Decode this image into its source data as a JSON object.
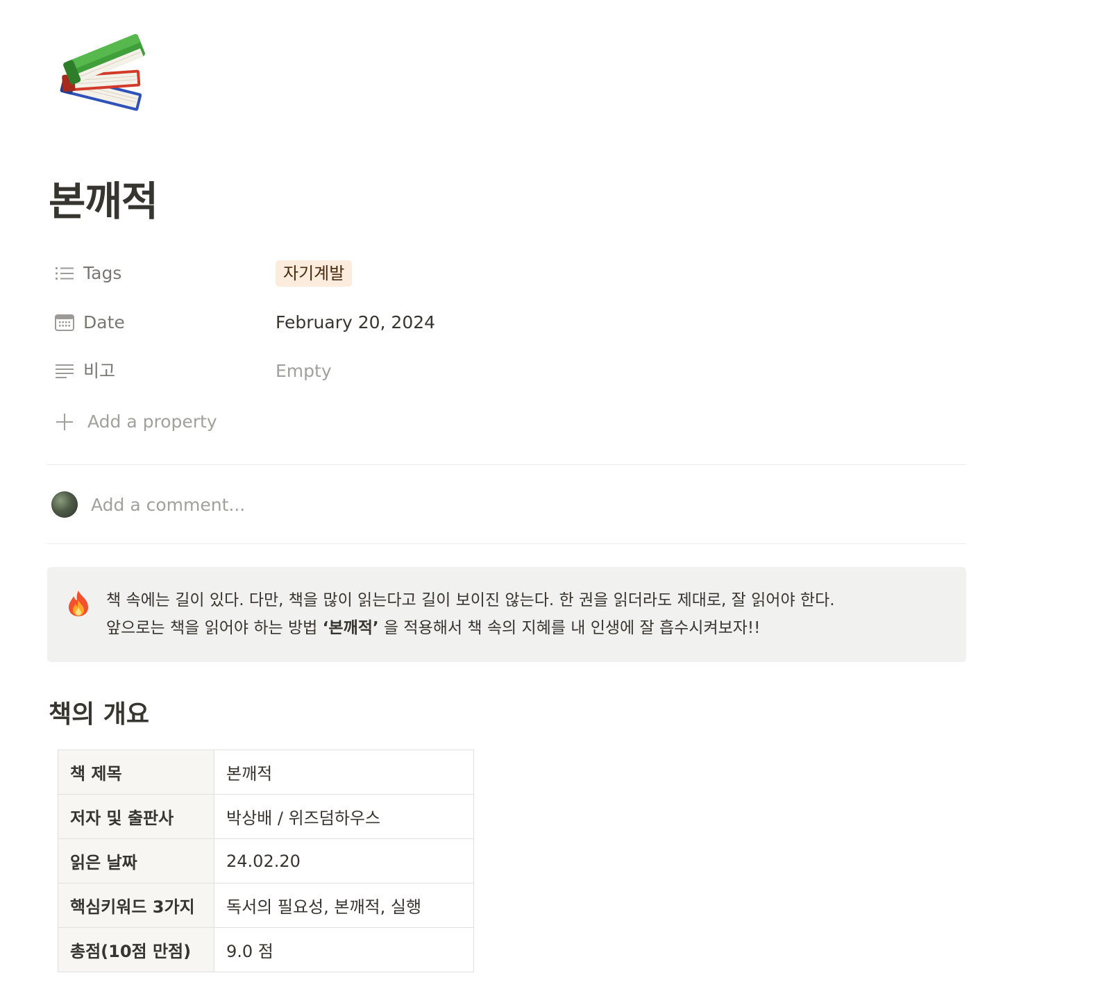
{
  "page": {
    "icon": "books-emoji-icon",
    "title": "본깨적"
  },
  "properties": [
    {
      "name": "Tags",
      "icon": "list-icon",
      "type": "tag",
      "value": "자기계발",
      "tag_color": "#fbecdd"
    },
    {
      "name": "Date",
      "icon": "calendar-icon",
      "type": "date",
      "value": "February 20, 2024"
    },
    {
      "name": "비고",
      "icon": "text-lines-icon",
      "type": "empty",
      "value": "Empty"
    }
  ],
  "add_property": {
    "label": "Add a property",
    "icon": "plus-icon"
  },
  "comment": {
    "placeholder": "Add a comment..."
  },
  "callout": {
    "icon": "fire-emoji-icon",
    "line1": "책 속에는 길이 있다. 다만, 책을 많이 읽는다고 길이 보이진 않는다. 한 권을 읽더라도 제대로, 잘 읽어야 한다.",
    "line2_before": "앞으로는 책을 읽어야 하는 방법 ",
    "line2_bold": "‘본깨적’",
    "line2_after": " 을 적용해서 책 속의 지혜를 내 인생에 잘 흡수시켜보자!!"
  },
  "overview": {
    "heading": "책의 개요",
    "rows": [
      {
        "key": "책 제목",
        "value": "본깨적"
      },
      {
        "key": "저자 및 출판사",
        "value": "박상배 / 위즈덤하우스"
      },
      {
        "key": "읽은 날짜",
        "value": "24.02.20"
      },
      {
        "key": "핵심키워드 3가지",
        "value": "독서의 필요성, 본깨적, 실행"
      },
      {
        "key": "총점(10점 만점)",
        "value": "9.0 점"
      }
    ]
  }
}
